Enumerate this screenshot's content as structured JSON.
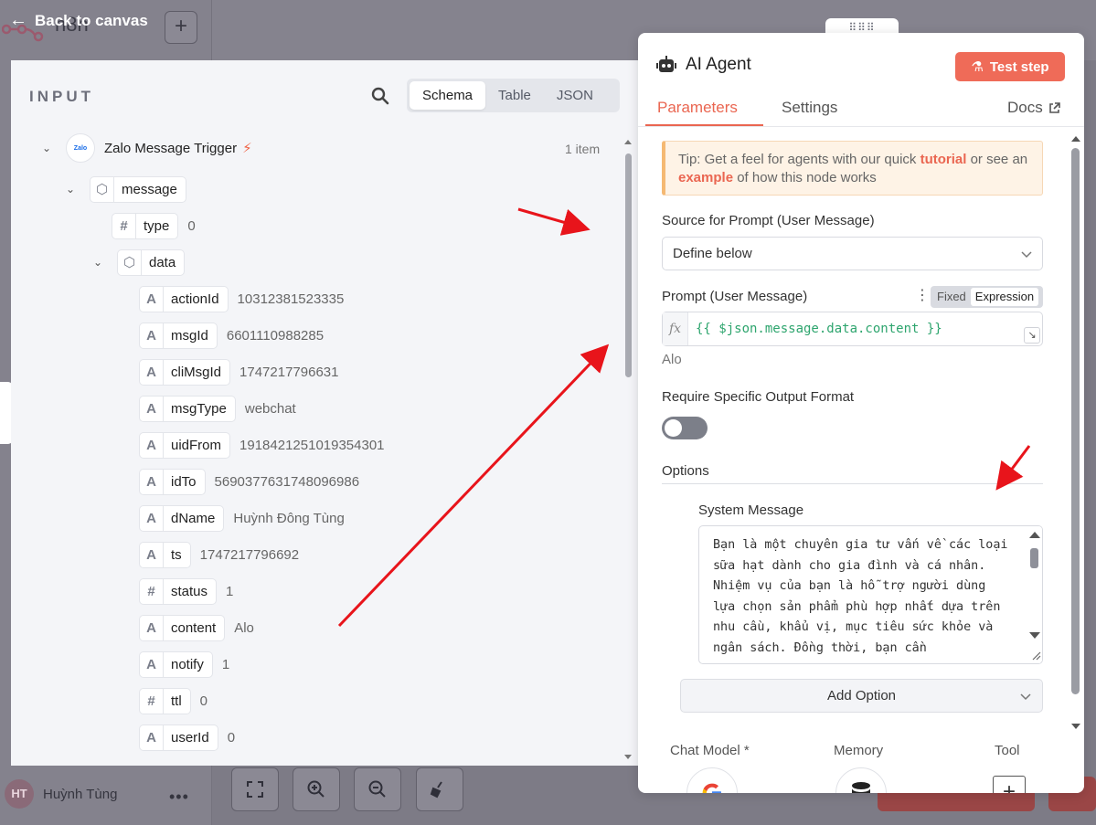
{
  "canvas": {
    "back_label": "Back to canvas",
    "workflow_title": "n8n",
    "user": {
      "initials": "HT",
      "name": "Huỳnh Tùng"
    }
  },
  "input_panel": {
    "title": "INPUT",
    "view_tabs": [
      "Schema",
      "Table",
      "JSON"
    ],
    "active_view": "Schema",
    "trigger": {
      "name": "Zalo Message Trigger",
      "logo_text": "Zalo",
      "count": "1 item"
    },
    "nodes": {
      "message": "message",
      "type": {
        "name": "type",
        "value": "0"
      },
      "data": "data"
    },
    "fields": [
      {
        "kind": "A",
        "name": "actionId",
        "value": "10312381523335"
      },
      {
        "kind": "A",
        "name": "msgId",
        "value": "6601110988285"
      },
      {
        "kind": "A",
        "name": "cliMsgId",
        "value": "1747217796631"
      },
      {
        "kind": "A",
        "name": "msgType",
        "value": "webchat"
      },
      {
        "kind": "A",
        "name": "uidFrom",
        "value": "1918421251019354301"
      },
      {
        "kind": "A",
        "name": "idTo",
        "value": "5690377631748096986"
      },
      {
        "kind": "A",
        "name": "dName",
        "value": "Huỳnh Đông Tùng"
      },
      {
        "kind": "A",
        "name": "ts",
        "value": "1747217796692"
      },
      {
        "kind": "#",
        "name": "status",
        "value": "1"
      },
      {
        "kind": "A",
        "name": "content",
        "value": "Alo"
      },
      {
        "kind": "A",
        "name": "notify",
        "value": "1"
      },
      {
        "kind": "#",
        "name": "ttl",
        "value": "0"
      },
      {
        "kind": "A",
        "name": "userId",
        "value": "0"
      }
    ]
  },
  "agent_panel": {
    "title": "AI Agent",
    "test_button": "Test step",
    "tabs": [
      "Parameters",
      "Settings"
    ],
    "active_tab": "Parameters",
    "docs_label": "Docs",
    "tip": {
      "prefix": "Tip: Get a feel for agents with our quick ",
      "link1": "tutorial",
      "middle": " or see an ",
      "link2": "example",
      "suffix": " of how this node works"
    },
    "source_label": "Source for Prompt (User Message)",
    "source_value": "Define below",
    "prompt_label": "Prompt (User Message)",
    "prompt_mode": {
      "fixed": "Fixed",
      "expression": "Expression",
      "active": "Expression"
    },
    "prompt_expression": "{{ $json.message.data.content }}",
    "prompt_result": "Alo",
    "output_format_label": "Require Specific Output Format",
    "output_format_enabled": false,
    "options_label": "Options",
    "system_message_label": "System Message",
    "system_message": "Bạn là một chuyên gia tư vấn về các loại sữa hạt dành cho gia đình và cá nhân. Nhiệm vụ của bạn là hỗ trợ người dùng lựa chọn sản phẩm phù hợp nhất dựa trên nhu cầu, khẩu vị, mục tiêu sức khỏe và ngân sách. Đồng thời, bạn cần",
    "add_option_label": "Add Option",
    "sub_nodes": [
      "Chat Model *",
      "Memory",
      "Tool"
    ]
  }
}
